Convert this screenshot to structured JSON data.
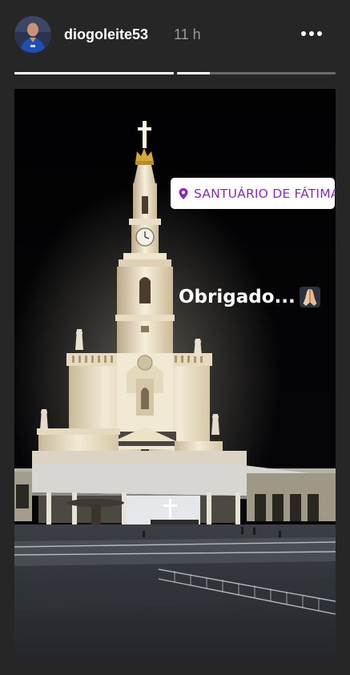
{
  "header": {
    "username": "diogoleite53",
    "timestamp": "11 h",
    "avatar_icon": "profile-avatar",
    "more_icon": "more-options-icon"
  },
  "progress": {
    "segments": [
      {
        "fill": 1.0
      },
      {
        "fill": 0.21
      }
    ]
  },
  "story": {
    "location_sticker": {
      "label": "SANTUÁRIO DE FÁTIMA",
      "icon": "location-pin-icon",
      "color": "#8a2bb8"
    },
    "caption": {
      "text": "Obrigado...",
      "emoji_icon": "folded-hands-emoji"
    }
  }
}
